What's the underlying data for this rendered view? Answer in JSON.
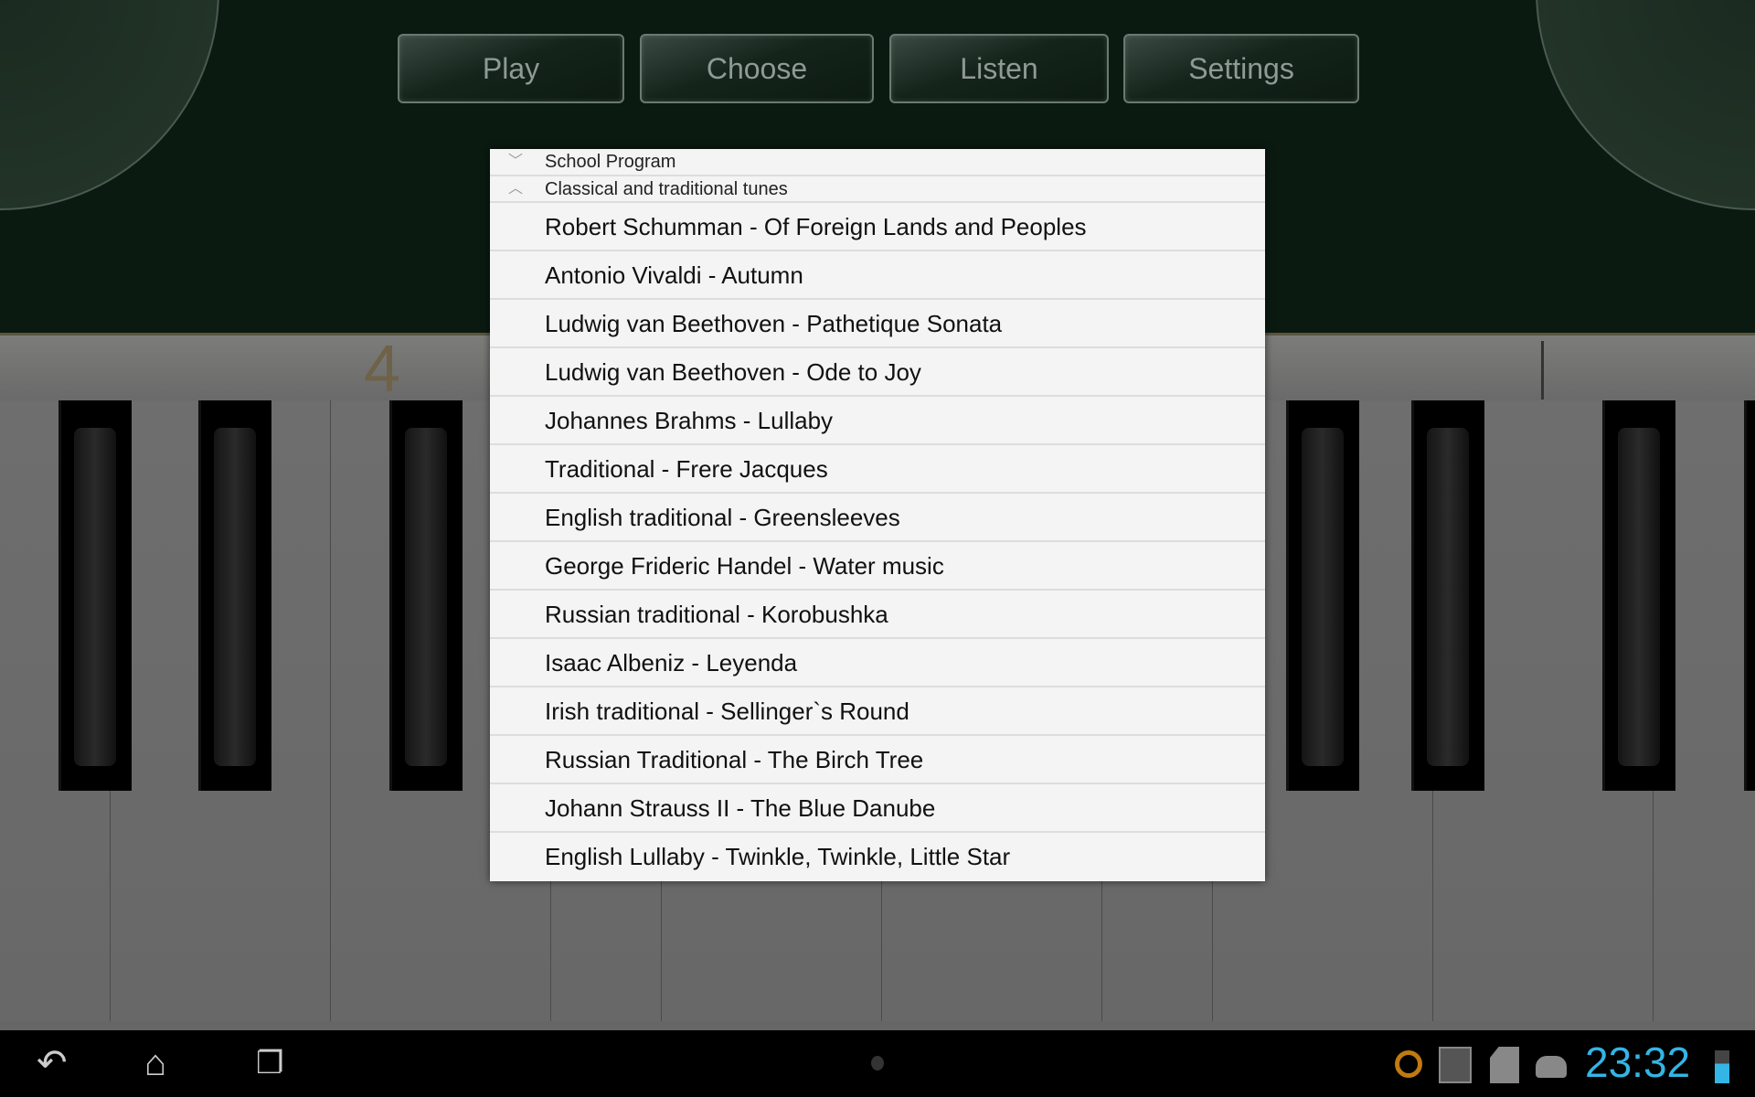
{
  "toolbar": {
    "play": "Play",
    "choose": "Choose",
    "listen": "Listen",
    "settings": "Settings"
  },
  "keyboard": {
    "octave_label": "4"
  },
  "menu": {
    "groups": [
      {
        "label": "School Program",
        "icon": "chevron-down-icon",
        "expanded": false
      },
      {
        "label": "Classical and traditional tunes",
        "icon": "chevron-up-icon",
        "expanded": true
      }
    ],
    "items": [
      "Robert Schumman - Of Foreign Lands and Peoples",
      "Antonio Vivaldi - Autumn",
      "Ludwig van Beethoven - Pathetique Sonata",
      "Ludwig van Beethoven - Ode to Joy",
      "Johannes Brahms - Lullaby",
      "Traditional - Frere Jacques",
      "English traditional - Greensleeves",
      "George Frideric Handel - Water music",
      "Russian traditional - Korobushka",
      "Isaac Albeniz - Leyenda",
      "Irish traditional - Sellinger`s Round",
      "Russian Traditional - The Birch Tree",
      "Johann Strauss II - The Blue Danube",
      "English Lullaby - Twinkle, Twinkle, Little Star"
    ]
  },
  "statusbar": {
    "time": "23:32",
    "clock_color": "#33b5e5"
  }
}
